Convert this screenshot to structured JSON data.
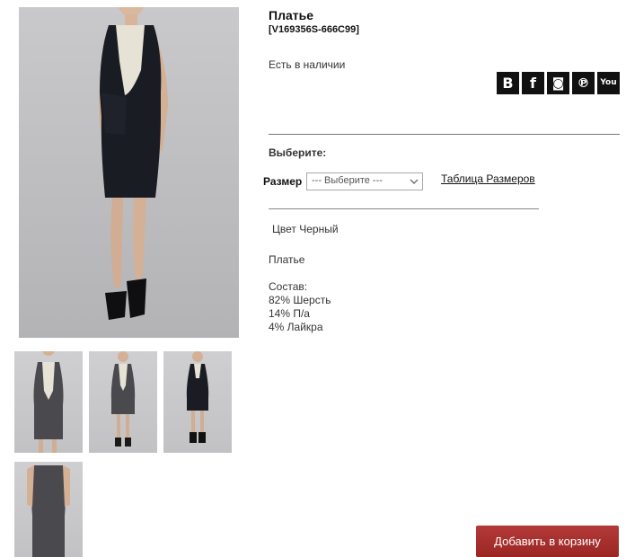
{
  "product": {
    "title": "Платье",
    "sku": "[V169356S-666C99]",
    "stock": "Есть в наличии",
    "choose_label": "Выберите:",
    "size_label": "Размер",
    "size_select_value": "--- Выберите ---",
    "size_table_link": "Таблица Размеров",
    "color_text": "Цвет Черный",
    "description": "Платье",
    "composition": [
      "Состав:",
      "82% Шерсть",
      "14% П/а",
      "4% Лайкра"
    ],
    "add_to_cart": "Добавить в корзину"
  },
  "social": [
    {
      "name": "vk-icon",
      "glyph": "B"
    },
    {
      "name": "facebook-icon",
      "glyph": "f"
    },
    {
      "name": "instagram-icon",
      "glyph": "◙"
    },
    {
      "name": "pinterest-icon",
      "glyph": "℗"
    },
    {
      "name": "youtube-icon",
      "glyph": "You"
    }
  ],
  "colors": {
    "cart_button": "#a52e2c",
    "social_bg": "#111111",
    "dress_dark": "#1a1c24",
    "dress_grey": "#4a4a4e",
    "panel_cream": "#e6e2d6"
  }
}
